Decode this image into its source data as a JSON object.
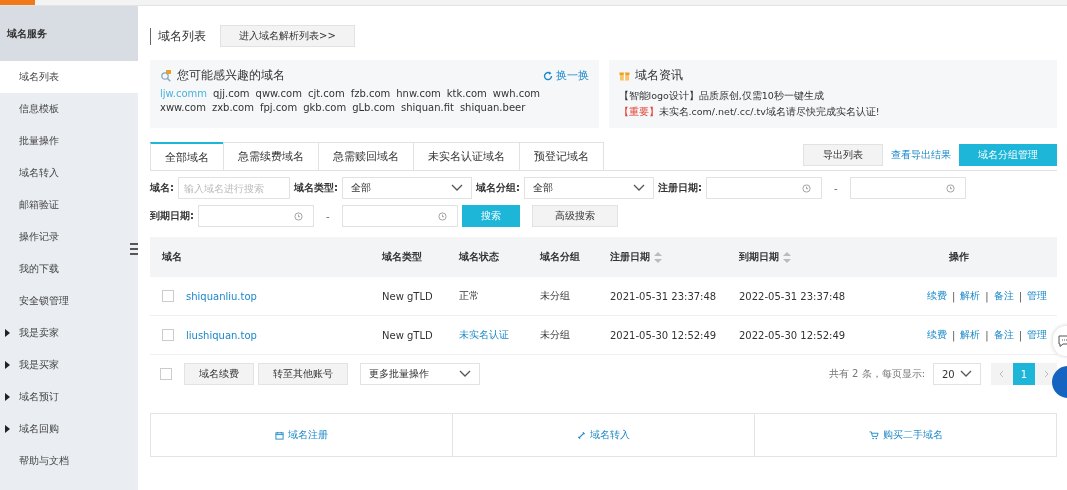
{
  "sidebar": {
    "title": "域名服务",
    "items": [
      {
        "label": "域名列表",
        "selected": true,
        "kind": "link"
      },
      {
        "label": "信息模板",
        "selected": false,
        "kind": "link"
      },
      {
        "label": "批量操作",
        "selected": false,
        "kind": "link"
      },
      {
        "label": "域名转入",
        "selected": false,
        "kind": "link"
      },
      {
        "label": "邮箱验证",
        "selected": false,
        "kind": "link"
      },
      {
        "label": "操作记录",
        "selected": false,
        "kind": "link"
      },
      {
        "label": "我的下载",
        "selected": false,
        "kind": "link"
      },
      {
        "label": "安全锁管理",
        "selected": false,
        "kind": "link"
      },
      {
        "label": "我是卖家",
        "selected": false,
        "kind": "group",
        "expanded": false
      },
      {
        "label": "我是买家",
        "selected": false,
        "kind": "group",
        "expanded": false
      },
      {
        "label": "域名预订",
        "selected": false,
        "kind": "group",
        "expanded": false
      },
      {
        "label": "域名回购",
        "selected": false,
        "kind": "group",
        "expanded": false
      },
      {
        "label": "帮助与文档",
        "selected": false,
        "kind": "link"
      }
    ]
  },
  "header": {
    "title": "域名列表",
    "button": "进入域名解析列表>>"
  },
  "suggestions": {
    "title": "您可能感兴趣的域名",
    "refresh": "换一换",
    "domains": [
      {
        "text": "ljw.comm",
        "selected": true
      },
      {
        "text": "qjj.com",
        "selected": false
      },
      {
        "text": "qww.com",
        "selected": false
      },
      {
        "text": "cjt.com",
        "selected": false
      },
      {
        "text": "fzb.com",
        "selected": false
      },
      {
        "text": "hnw.com",
        "selected": false
      },
      {
        "text": "ktk.com",
        "selected": false
      },
      {
        "text": "wwh.com",
        "selected": false
      },
      {
        "text": "xww.com",
        "selected": false
      },
      {
        "text": "zxb.com",
        "selected": false
      },
      {
        "text": "fpj.com",
        "selected": false
      },
      {
        "text": "gkb.com",
        "selected": false
      },
      {
        "text": "gLb.com",
        "selected": false
      },
      {
        "text": "shiquan.fit",
        "selected": false
      },
      {
        "text": "shiquan.beer",
        "selected": false
      }
    ]
  },
  "news": {
    "title": "域名资讯",
    "items": [
      {
        "tag": "【智能logo设计】",
        "text": "品质原创,仅需10秒一键生成",
        "important": false
      },
      {
        "tag": "【重要】",
        "text": "未实名.com/.net/.cc/.tv域名请尽快完成实名认证!",
        "important": true
      }
    ]
  },
  "tabs": [
    {
      "label": "全部域名",
      "selected": true
    },
    {
      "label": "急需续费域名",
      "selected": false
    },
    {
      "label": "急需赎回域名",
      "selected": false
    },
    {
      "label": "未实名认证域名",
      "selected": false
    },
    {
      "label": "预登记域名",
      "selected": false
    }
  ],
  "toolbar": [
    {
      "label": "导出列表",
      "kind": "button"
    },
    {
      "label": "查看导出结果",
      "kind": "link"
    },
    {
      "label": "域名分组管理",
      "kind": "primary"
    }
  ],
  "filters": [
    [
      {
        "kind": "label",
        "text": "域名:"
      },
      {
        "kind": "input",
        "placeholder": "输入域名进行搜索"
      },
      {
        "kind": "label",
        "text": "域名类型:"
      },
      {
        "kind": "select",
        "value": "全部"
      },
      {
        "kind": "label",
        "text": "域名分组:"
      },
      {
        "kind": "select",
        "value": "全部"
      },
      {
        "kind": "label",
        "text": "注册日期:"
      },
      {
        "kind": "date"
      },
      {
        "kind": "dash",
        "text": "-"
      },
      {
        "kind": "date"
      }
    ],
    [
      {
        "kind": "label",
        "text": "到期日期:"
      },
      {
        "kind": "date"
      },
      {
        "kind": "dash",
        "text": "-"
      },
      {
        "kind": "date"
      },
      {
        "kind": "primary",
        "text": "搜索"
      },
      {
        "kind": "button",
        "text": "高级搜索"
      }
    ]
  ],
  "table": {
    "separator": "|",
    "columns": [
      {
        "label": "域名",
        "sortable": false
      },
      {
        "label": "域名类型",
        "sortable": false
      },
      {
        "label": "域名状态",
        "sortable": false
      },
      {
        "label": "域名分组",
        "sortable": false
      },
      {
        "label": "注册日期",
        "sortable": true
      },
      {
        "label": "到期日期",
        "sortable": true
      },
      {
        "label": "操作",
        "sortable": false
      }
    ],
    "rows": [
      {
        "checked": false,
        "domain": "shiquanliu.top",
        "type": "New gTLD",
        "status": {
          "text": "正常",
          "kind": "plain"
        },
        "group": "未分组",
        "registered": "2021-05-31 23:37:48",
        "expires": "2022-05-31 23:37:48",
        "actions": [
          "续费",
          "解析",
          "备注",
          "管理"
        ]
      },
      {
        "checked": false,
        "domain": "liushiquan.top",
        "type": "New gTLD",
        "status": {
          "text": "未实名认证",
          "kind": "link"
        },
        "group": "未分组",
        "registered": "2021-05-30 12:52:49",
        "expires": "2022-05-30 12:52:49",
        "actions": [
          "续费",
          "解析",
          "备注",
          "管理"
        ]
      }
    ]
  },
  "footer": {
    "select_all": {
      "checked": false
    },
    "buttons": [
      "域名续费",
      "转至其他账号"
    ],
    "more": "更多批量操作",
    "total": "共有 2 条，每页显示:",
    "page_size": "20",
    "pages": [
      {
        "label": "1",
        "selected": true
      }
    ]
  },
  "links": [
    {
      "label": "域名注册",
      "kind": "register"
    },
    {
      "label": "域名转入",
      "kind": "transfer"
    },
    {
      "label": "购买二手域名",
      "kind": "buy"
    }
  ]
}
